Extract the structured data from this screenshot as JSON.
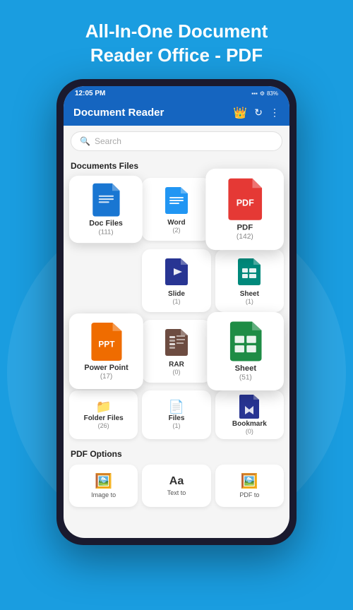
{
  "app": {
    "title_line1": "All-In-One Document",
    "title_line2": "Reader Office - PDF"
  },
  "phone": {
    "status_bar": {
      "time": "12:05 PM",
      "battery": "83%"
    },
    "header": {
      "title": "Document Reader"
    },
    "search": {
      "placeholder": "Search"
    },
    "sections": [
      {
        "id": "documents_files",
        "label": "Documents Files",
        "items": [
          {
            "id": "doc",
            "label": "Doc Files",
            "count": "(111)",
            "color": "blue",
            "icon_text": "≡",
            "size": "large"
          },
          {
            "id": "word",
            "label": "Word",
            "count": "(2)",
            "color": "blue-doc",
            "icon_text": "W"
          },
          {
            "id": "pdf",
            "label": "PDF",
            "count": "(142)",
            "color": "red",
            "icon_text": "PDF",
            "size": "large-right"
          },
          {
            "id": "slide",
            "label": "Slide",
            "count": "(1)",
            "color": "dark-blue",
            "icon_text": "▶"
          },
          {
            "id": "sheet",
            "label": "Sheet",
            "count": "(1)",
            "color": "teal",
            "icon_text": "⊞"
          },
          {
            "id": "ppt",
            "label": "Power Point",
            "count": "(17)",
            "color": "orange",
            "icon_text": "PPT",
            "size": "large"
          },
          {
            "id": "rar",
            "label": "RAR",
            "count": "(0)",
            "color": "brown",
            "icon_text": "⊟"
          },
          {
            "id": "sheet2",
            "label": "Sheet",
            "count": "(51)",
            "color": "green-sheet",
            "icon_text": "⊞",
            "size": "large-right"
          },
          {
            "id": "folder",
            "label": "Folder Files",
            "count": "(26)"
          },
          {
            "id": "files",
            "label": "Files",
            "count": "(1)"
          },
          {
            "id": "bookmark",
            "label": "Bookmark",
            "count": "(0)",
            "color": "dark-blue",
            "icon_text": "🔖"
          }
        ]
      },
      {
        "id": "pdf_options",
        "label": "PDF Options",
        "items": [
          {
            "id": "image_to",
            "label": "Image to",
            "icon": "🖼️"
          },
          {
            "id": "text_to",
            "label": "Text to",
            "icon": "Aa"
          },
          {
            "id": "pdf_to",
            "label": "PDF to",
            "icon": "🖼️"
          }
        ]
      }
    ]
  }
}
